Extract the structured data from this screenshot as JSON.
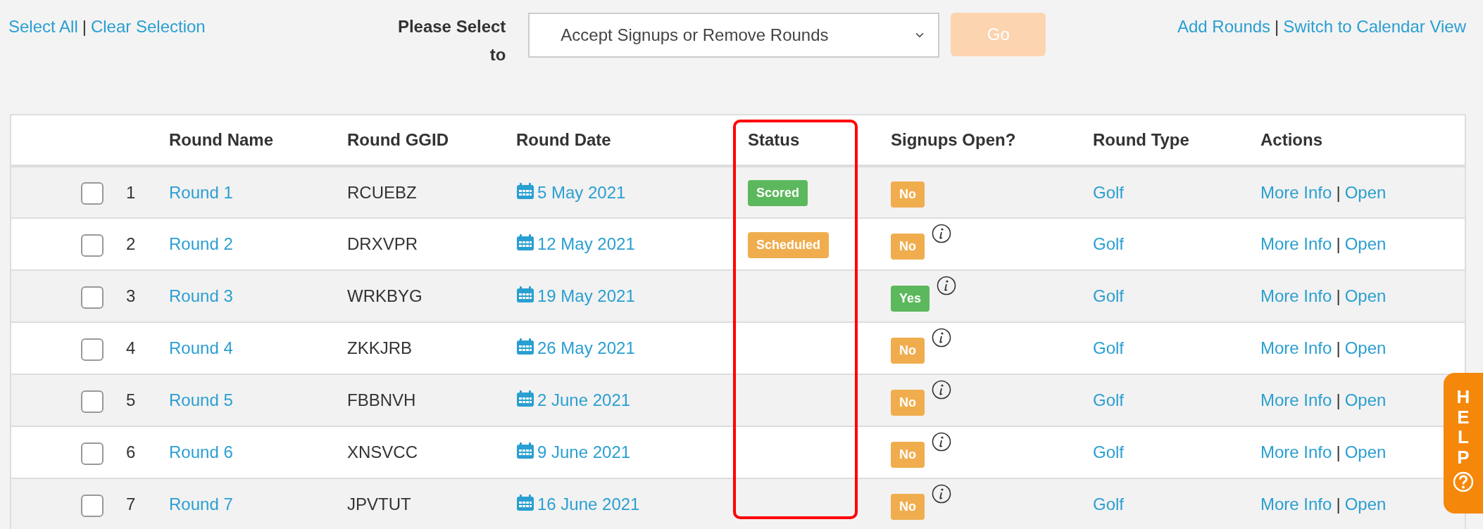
{
  "toolbar": {
    "left_links": [
      "Select All",
      "Clear Selection"
    ],
    "left_separator": "|",
    "select_label": "Please Select to",
    "select_value": "Accept Signups or Remove Rounds",
    "go_button": {
      "label": "Go",
      "disabled": true
    },
    "right_links": [
      "Add Rounds",
      "Switch to Calendar View"
    ],
    "right_separator": "|"
  },
  "table": {
    "columns": [
      {
        "highlighted": false
      },
      {
        "highlighted": false
      },
      {
        "label": "Round Name",
        "highlighted": false
      },
      {
        "label": "Round GGID",
        "highlighted": false
      },
      {
        "label": "Round Date",
        "highlighted": false
      },
      {
        "label": "Status",
        "highlighted": true
      },
      {
        "label": "Signups Open?",
        "highlighted": false
      },
      {
        "label": "Round Type",
        "highlighted": false
      },
      {
        "label": "Actions",
        "highlighted": false
      }
    ],
    "rows": [
      {
        "checked": false,
        "number": "1",
        "name": "Round 1",
        "ggid": "RCUEBZ",
        "date": "5 May 2021",
        "status": {
          "label": "Scored",
          "kind": "scored"
        },
        "signups": {
          "label": "No",
          "open": false,
          "info": false
        },
        "type": "Golf",
        "actions": [
          "More Info",
          "Open"
        ],
        "actions_separator": "|"
      },
      {
        "checked": false,
        "number": "2",
        "name": "Round 2",
        "ggid": "DRXVPR",
        "date": "12 May 2021",
        "status": {
          "label": "Scheduled",
          "kind": "scheduled"
        },
        "signups": {
          "label": "No",
          "open": false,
          "info": true
        },
        "type": "Golf",
        "actions": [
          "More Info",
          "Open"
        ],
        "actions_separator": "|"
      },
      {
        "checked": false,
        "number": "3",
        "name": "Round 3",
        "ggid": "WRKBYG",
        "date": "19 May 2021",
        "signups": {
          "label": "Yes",
          "open": true,
          "info": true
        },
        "type": "Golf",
        "actions": [
          "More Info",
          "Open"
        ],
        "actions_separator": "|"
      },
      {
        "checked": false,
        "number": "4",
        "name": "Round 4",
        "ggid": "ZKKJRB",
        "date": "26 May 2021",
        "signups": {
          "label": "No",
          "open": false,
          "info": true
        },
        "type": "Golf",
        "actions": [
          "More Info",
          "Open"
        ],
        "actions_separator": "|"
      },
      {
        "checked": false,
        "number": "5",
        "name": "Round 5",
        "ggid": "FBBNVH",
        "date": "2 June 2021",
        "signups": {
          "label": "No",
          "open": false,
          "info": true
        },
        "type": "Golf",
        "actions": [
          "More Info",
          "Open"
        ],
        "actions_separator": "|"
      },
      {
        "checked": false,
        "number": "6",
        "name": "Round 6",
        "ggid": "XNSVCC",
        "date": "9 June 2021",
        "signups": {
          "label": "No",
          "open": false,
          "info": true
        },
        "type": "Golf",
        "actions": [
          "More Info",
          "Open"
        ],
        "actions_separator": "|"
      },
      {
        "checked": false,
        "number": "7",
        "name": "Round 7",
        "ggid": "JPVTUT",
        "date": "16 June 2021",
        "signups": {
          "label": "No",
          "open": false,
          "info": true
        },
        "type": "Golf",
        "actions": [
          "More Info",
          "Open"
        ],
        "actions_separator": "|"
      }
    ]
  },
  "help_tab": {
    "label": "HELP"
  }
}
